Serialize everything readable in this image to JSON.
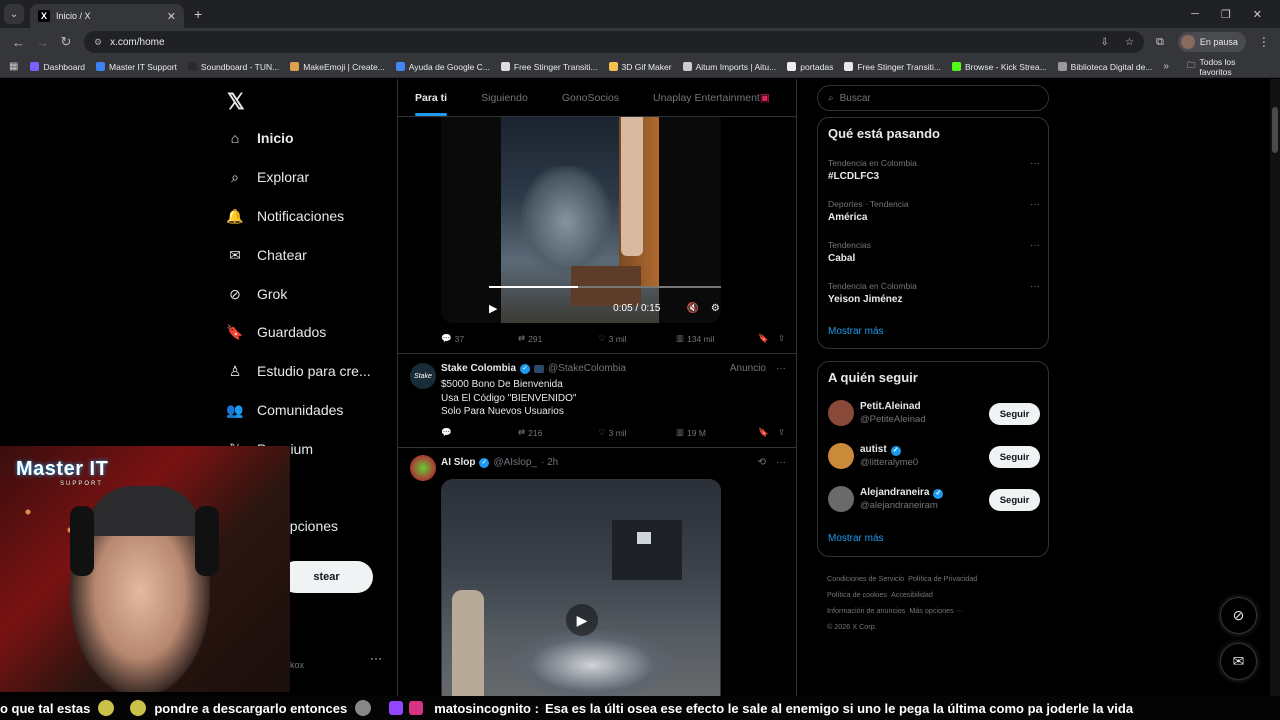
{
  "browser": {
    "tab_title": "Inicio / X",
    "url": "x.com/home",
    "profile_label": "En pausa",
    "bookmarks": [
      {
        "label": "Dashboard",
        "color": "#7b61ff"
      },
      {
        "label": "Master IT Support",
        "color": "#3b82f6"
      },
      {
        "label": "Soundboard - TUN...",
        "color": "#2b2b2b"
      },
      {
        "label": "MakeEmoji | Create...",
        "color": "#e0a050"
      },
      {
        "label": "Ayuda de Google C...",
        "color": "#4285f4"
      },
      {
        "label": "Free Stinger Transiti...",
        "color": "#dddddd"
      },
      {
        "label": "3D Gif Maker",
        "color": "#f2c14e"
      },
      {
        "label": "Aitum Imports | Aitu...",
        "color": "#cccccc"
      },
      {
        "label": "portadas",
        "color": "#eeeeee"
      },
      {
        "label": "Free Stinger Transiti...",
        "color": "#e8e8e8"
      },
      {
        "label": "Browse - Kick Strea...",
        "color": "#53fc18"
      },
      {
        "label": "Biblioteca Digital de...",
        "color": "#999999"
      }
    ],
    "bookmarks_all": "Todos los favoritos"
  },
  "nav": {
    "items": [
      {
        "label": "Inicio",
        "icon": "home-icon",
        "active": true
      },
      {
        "label": "Explorar",
        "icon": "search-icon"
      },
      {
        "label": "Notificaciones",
        "icon": "bell-icon"
      },
      {
        "label": "Chatear",
        "icon": "mail-icon"
      },
      {
        "label": "Grok",
        "icon": "grok-icon"
      },
      {
        "label": "Guardados",
        "icon": "bookmark-icon"
      },
      {
        "label": "Estudio para cre...",
        "icon": "studio-icon"
      },
      {
        "label": "Comunidades",
        "icon": "communities-icon"
      },
      {
        "label": "Premium",
        "icon": "x-icon"
      },
      {
        "label": "opciones",
        "icon": "more-icon"
      }
    ],
    "post_button": "stear",
    "account_handle": "kox"
  },
  "timeline": {
    "tabs": [
      "Para ti",
      "Siguiendo",
      "GonoSocios",
      "Unaplay Entertainment"
    ],
    "video1": {
      "time": "0:05 / 0:15",
      "progress": 0.33
    },
    "post1_actions": {
      "replies": "37",
      "reposts": "291",
      "likes": "3 mil",
      "views": "134 mil"
    },
    "ad": {
      "name": "Stake Colombia",
      "handle": "@StakeColombia",
      "label": "Anuncio",
      "line1": "$5000 Bono De Bienvenida",
      "line2": "Usa El Código \"BIENVENIDO\"",
      "line3": "Solo Para Nuevos Usuarios",
      "reposts": "216",
      "likes": "3 mil",
      "views": "19 M"
    },
    "post3": {
      "name": "AI Slop",
      "handle": "@AIslop_",
      "time": "· 2h"
    }
  },
  "right": {
    "search_placeholder": "Buscar",
    "trends_title": "Qué está pasando",
    "trends": [
      {
        "context": "Tendencia en Colombia",
        "name": "#LCDLFC3"
      },
      {
        "context": "Deportes · Tendencia",
        "name": "América"
      },
      {
        "context": "Tendencias",
        "name": "Cabal"
      },
      {
        "context": "Tendencia en Colombia",
        "name": "Yeison Jiménez"
      }
    ],
    "show_more": "Mostrar más",
    "follow_title": "A quién seguir",
    "suggestions": [
      {
        "name": "Petit.Aleinad",
        "handle": "@PetiteAleinad",
        "verified": false,
        "color": "#8a4a3a"
      },
      {
        "name": "autist",
        "handle": "@litteralyme0",
        "verified": true,
        "color": "#c98a3a"
      },
      {
        "name": "Alejandraneira",
        "handle": "@alejandraneiram",
        "verified": true,
        "color": "#6a6a6a"
      }
    ],
    "follow_label": "Seguir",
    "footer": [
      "Condiciones de Servicio",
      "Política de Privacidad",
      "Política de cookies",
      "Accesibilidad",
      "Información de anuncios",
      "Más opciones ···",
      "© 2026 X Corp."
    ]
  },
  "overlay": {
    "brand_big": "Master IT",
    "brand_small": "SUPPORT",
    "chat_a": "o que tal estas",
    "chat_b": "pondre a descargarlo entonces",
    "chat_user": "matosincognito :",
    "chat_msg": "Esa es la últi osea ese efecto le sale al enemigo si uno le pega la última como pa joderle la vida"
  }
}
